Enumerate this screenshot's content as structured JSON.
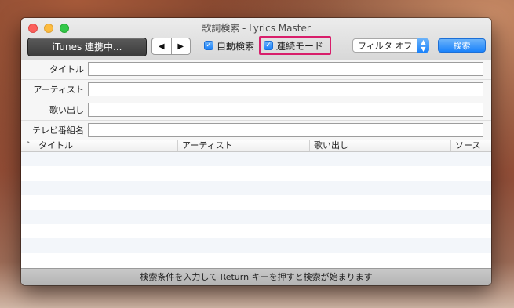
{
  "window": {
    "title": "歌詞検索 - Lyrics Master"
  },
  "toolbar": {
    "itunes_label": "iTunes 連携中...",
    "prev_icon": "◀",
    "next_icon": "▶",
    "auto_search_label": "自動検索",
    "auto_search_checked": true,
    "continuous_mode_label": "連続モード",
    "continuous_mode_checked": true,
    "filter_value": "フィルタ オフ",
    "search_label": "検索"
  },
  "form": {
    "fields": [
      {
        "label": "タイトル",
        "value": ""
      },
      {
        "label": "アーティスト",
        "value": ""
      },
      {
        "label": "歌い出し",
        "value": ""
      },
      {
        "label": "テレビ番組名",
        "value": ""
      }
    ]
  },
  "table": {
    "sort_indicator": "^",
    "columns": [
      "タイトル",
      "アーティスト",
      "歌い出し",
      "ソース"
    ],
    "rows": []
  },
  "status": {
    "message": "検索条件を入力して Return キーを押すと検索が始まります"
  },
  "colors": {
    "accent": "#1a82fb",
    "highlight": "#d81e6b"
  }
}
